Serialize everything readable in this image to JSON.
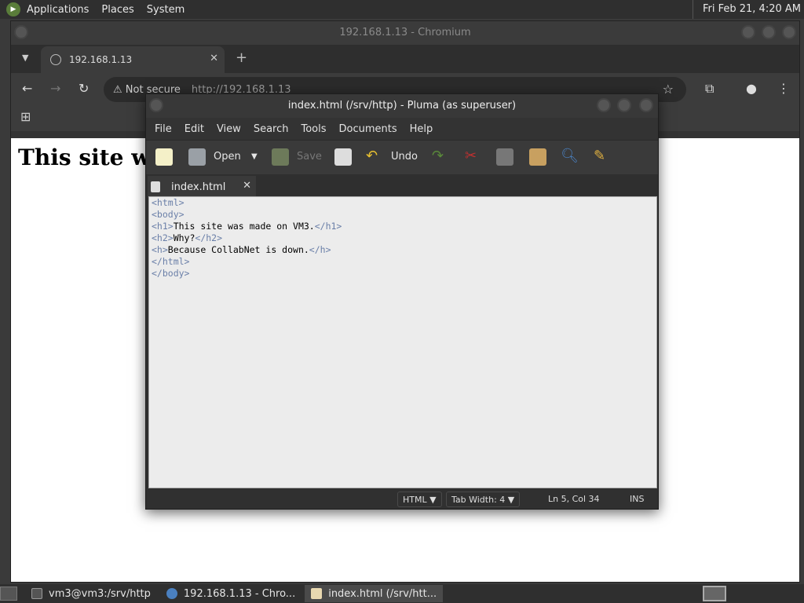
{
  "top_panel": {
    "menus": [
      "Applications",
      "Places",
      "System"
    ],
    "clock": "Fri Feb 21,  4:20 AM"
  },
  "chromium": {
    "window_title": "192.168.1.13 - Chromium",
    "tab_title": "192.168.1.13",
    "not_secure": "Not secure",
    "url": "http://192.168.1.13",
    "page_heading": "This site wa"
  },
  "pluma": {
    "window_title": "index.html (/srv/http) - Pluma (as superuser)",
    "menu": [
      "File",
      "Edit",
      "View",
      "Search",
      "Tools",
      "Documents",
      "Help"
    ],
    "toolbar": {
      "open": "Open",
      "save": "Save",
      "undo": "Undo"
    },
    "doc_tab": "index.html",
    "code_lines": [
      {
        "tag_open": "<html>",
        "text": "",
        "tag_close": ""
      },
      {
        "tag_open": "<body>",
        "text": "",
        "tag_close": ""
      },
      {
        "tag_open": "<h1>",
        "text": "This site was made on VM3.",
        "tag_close": "</h1>"
      },
      {
        "tag_open": "<h2>",
        "text": "Why?",
        "tag_close": "</h2>"
      },
      {
        "tag_open": "<h>",
        "text": "Because CollabNet is down.",
        "tag_close": "</h>"
      },
      {
        "tag_open": "</html>",
        "text": "",
        "tag_close": ""
      },
      {
        "tag_open": "</body>",
        "text": "",
        "tag_close": ""
      }
    ],
    "status": {
      "language": "HTML",
      "tab_width": "Tab Width:  4",
      "position": "Ln 5, Col 34",
      "mode": "INS"
    }
  },
  "taskbar": {
    "items": [
      "vm3@vm3:/srv/http",
      "192.168.1.13 - Chro...",
      "index.html (/srv/htt..."
    ]
  }
}
